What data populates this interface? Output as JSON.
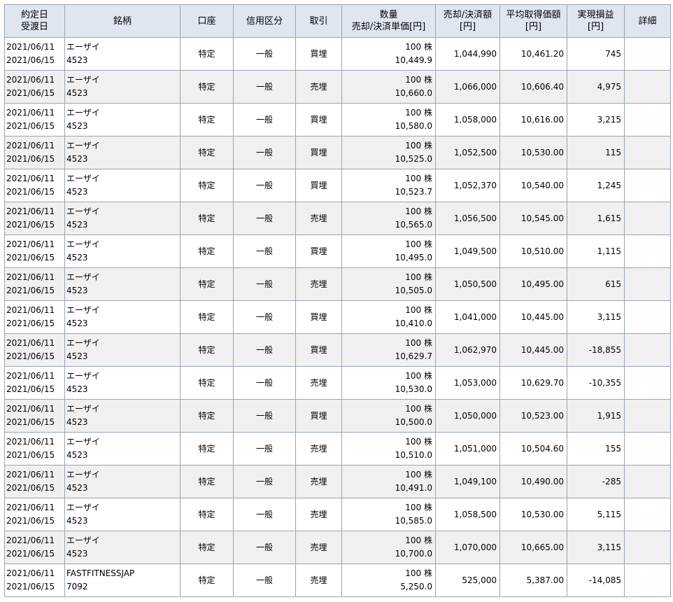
{
  "header": {
    "trade_date": "約定日",
    "settle_date": "受渡日",
    "stock": "銘柄",
    "account": "口座",
    "credit_type": "信用区分",
    "trade_type": "取引",
    "quantity": "数量",
    "unit_price": "売却/決済単価[円]",
    "amount": "売却/決済額",
    "amount_unit": "[円]",
    "avg_cost": "平均取得価額",
    "avg_cost_unit": "[円]",
    "realized_pl": "実現損益",
    "realized_pl_unit": "[円]",
    "detail": "詳細"
  },
  "rows": [
    {
      "trade_date": "2021/06/11",
      "settle_date": "2021/06/15",
      "name": "エーザイ",
      "code": "4523",
      "account": "特定",
      "credit": "一般",
      "type": "買埋",
      "qty": "100 株",
      "price": "10,449.9",
      "amount": "1,044,990",
      "avg": "10,461.20",
      "pl": "745"
    },
    {
      "trade_date": "2021/06/11",
      "settle_date": "2021/06/15",
      "name": "エーザイ",
      "code": "4523",
      "account": "特定",
      "credit": "一般",
      "type": "売埋",
      "qty": "100 株",
      "price": "10,660.0",
      "amount": "1,066,000",
      "avg": "10,606.40",
      "pl": "4,975"
    },
    {
      "trade_date": "2021/06/11",
      "settle_date": "2021/06/15",
      "name": "エーザイ",
      "code": "4523",
      "account": "特定",
      "credit": "一般",
      "type": "買埋",
      "qty": "100 株",
      "price": "10,580.0",
      "amount": "1,058,000",
      "avg": "10,616.00",
      "pl": "3,215"
    },
    {
      "trade_date": "2021/06/11",
      "settle_date": "2021/06/15",
      "name": "エーザイ",
      "code": "4523",
      "account": "特定",
      "credit": "一般",
      "type": "買埋",
      "qty": "100 株",
      "price": "10,525.0",
      "amount": "1,052,500",
      "avg": "10,530.00",
      "pl": "115"
    },
    {
      "trade_date": "2021/06/11",
      "settle_date": "2021/06/15",
      "name": "エーザイ",
      "code": "4523",
      "account": "特定",
      "credit": "一般",
      "type": "買埋",
      "qty": "100 株",
      "price": "10,523.7",
      "amount": "1,052,370",
      "avg": "10,540.00",
      "pl": "1,245"
    },
    {
      "trade_date": "2021/06/11",
      "settle_date": "2021/06/15",
      "name": "エーザイ",
      "code": "4523",
      "account": "特定",
      "credit": "一般",
      "type": "売埋",
      "qty": "100 株",
      "price": "10,565.0",
      "amount": "1,056,500",
      "avg": "10,545.00",
      "pl": "1,615"
    },
    {
      "trade_date": "2021/06/11",
      "settle_date": "2021/06/15",
      "name": "エーザイ",
      "code": "4523",
      "account": "特定",
      "credit": "一般",
      "type": "買埋",
      "qty": "100 株",
      "price": "10,495.0",
      "amount": "1,049,500",
      "avg": "10,510.00",
      "pl": "1,115"
    },
    {
      "trade_date": "2021/06/11",
      "settle_date": "2021/06/15",
      "name": "エーザイ",
      "code": "4523",
      "account": "特定",
      "credit": "一般",
      "type": "売埋",
      "qty": "100 株",
      "price": "10,505.0",
      "amount": "1,050,500",
      "avg": "10,495.00",
      "pl": "615"
    },
    {
      "trade_date": "2021/06/11",
      "settle_date": "2021/06/15",
      "name": "エーザイ",
      "code": "4523",
      "account": "特定",
      "credit": "一般",
      "type": "買埋",
      "qty": "100 株",
      "price": "10,410.0",
      "amount": "1,041,000",
      "avg": "10,445.00",
      "pl": "3,115"
    },
    {
      "trade_date": "2021/06/11",
      "settle_date": "2021/06/15",
      "name": "エーザイ",
      "code": "4523",
      "account": "特定",
      "credit": "一般",
      "type": "買埋",
      "qty": "100 株",
      "price": "10,629.7",
      "amount": "1,062,970",
      "avg": "10,445.00",
      "pl": "-18,855"
    },
    {
      "trade_date": "2021/06/11",
      "settle_date": "2021/06/15",
      "name": "エーザイ",
      "code": "4523",
      "account": "特定",
      "credit": "一般",
      "type": "売埋",
      "qty": "100 株",
      "price": "10,530.0",
      "amount": "1,053,000",
      "avg": "10,629.70",
      "pl": "-10,355"
    },
    {
      "trade_date": "2021/06/11",
      "settle_date": "2021/06/15",
      "name": "エーザイ",
      "code": "4523",
      "account": "特定",
      "credit": "一般",
      "type": "買埋",
      "qty": "100 株",
      "price": "10,500.0",
      "amount": "1,050,000",
      "avg": "10,523.00",
      "pl": "1,915"
    },
    {
      "trade_date": "2021/06/11",
      "settle_date": "2021/06/15",
      "name": "エーザイ",
      "code": "4523",
      "account": "特定",
      "credit": "一般",
      "type": "売埋",
      "qty": "100 株",
      "price": "10,510.0",
      "amount": "1,051,000",
      "avg": "10,504.60",
      "pl": "155"
    },
    {
      "trade_date": "2021/06/11",
      "settle_date": "2021/06/15",
      "name": "エーザイ",
      "code": "4523",
      "account": "特定",
      "credit": "一般",
      "type": "売埋",
      "qty": "100 株",
      "price": "10,491.0",
      "amount": "1,049,100",
      "avg": "10,490.00",
      "pl": "-285"
    },
    {
      "trade_date": "2021/06/11",
      "settle_date": "2021/06/15",
      "name": "エーザイ",
      "code": "4523",
      "account": "特定",
      "credit": "一般",
      "type": "売埋",
      "qty": "100 株",
      "price": "10,585.0",
      "amount": "1,058,500",
      "avg": "10,530.00",
      "pl": "5,115"
    },
    {
      "trade_date": "2021/06/11",
      "settle_date": "2021/06/15",
      "name": "エーザイ",
      "code": "4523",
      "account": "特定",
      "credit": "一般",
      "type": "売埋",
      "qty": "100 株",
      "price": "10,700.0",
      "amount": "1,070,000",
      "avg": "10,665.00",
      "pl": "3,115"
    },
    {
      "trade_date": "2021/06/11",
      "settle_date": "2021/06/15",
      "name": "FASTFITNESSJAP",
      "code": "7092",
      "account": "特定",
      "credit": "一般",
      "type": "売埋",
      "qty": "100 株",
      "price": "5,250.0",
      "amount": "525,000",
      "avg": "5,387.00",
      "pl": "-14,085"
    }
  ]
}
